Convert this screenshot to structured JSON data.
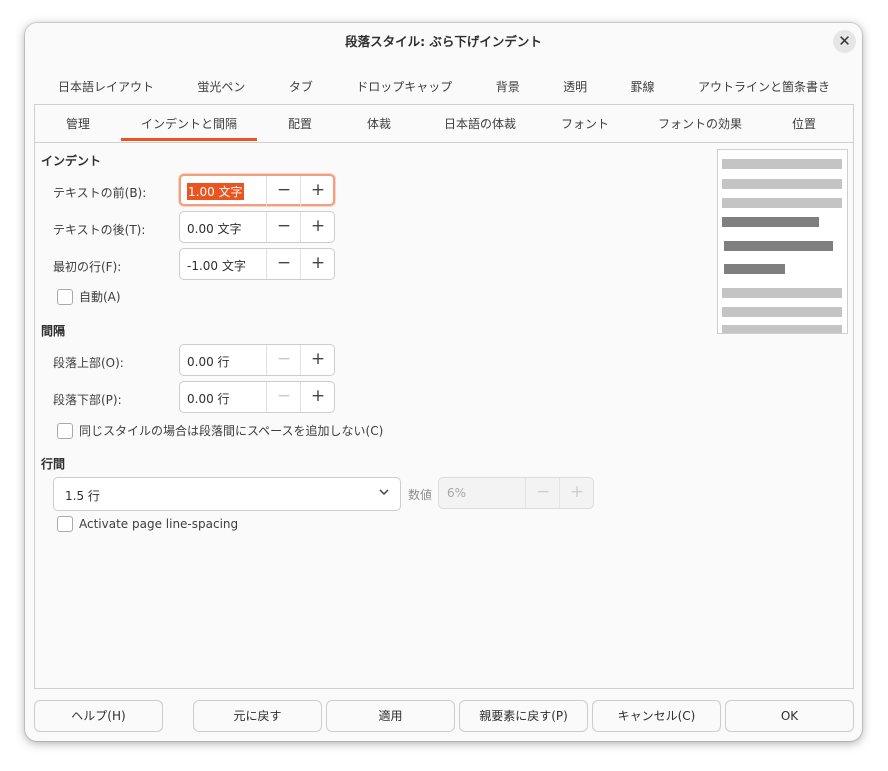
{
  "dialog": {
    "title": "段落スタイル: ぶら下げインデント"
  },
  "tabs_row1": [
    {
      "label": "日本語レイアウト"
    },
    {
      "label": "蛍光ペン"
    },
    {
      "label": "タブ"
    },
    {
      "label": "ドロップキャップ"
    },
    {
      "label": "背景"
    },
    {
      "label": "透明"
    },
    {
      "label": "罫線"
    },
    {
      "label": "アウトラインと箇条書き"
    }
  ],
  "tabs_row2": [
    {
      "label": "管理",
      "active": false
    },
    {
      "label": "インデントと間隔",
      "active": true
    },
    {
      "label": "配置",
      "active": false
    },
    {
      "label": "体裁",
      "active": false
    },
    {
      "label": "日本語の体裁",
      "active": false
    },
    {
      "label": "フォント",
      "active": false
    },
    {
      "label": "フォントの効果",
      "active": false
    },
    {
      "label": "位置",
      "active": false
    }
  ],
  "indent": {
    "title": "インデント",
    "before_label": "テキストの前(B):",
    "before_value": "1.00 文字",
    "after_label": "テキストの後(T):",
    "after_value": "0.00 文字",
    "first_label": "最初の行(F):",
    "first_value": "-1.00 文字",
    "auto_label": "自動(A)"
  },
  "spacing": {
    "title": "間隔",
    "above_label": "段落上部(O):",
    "above_value": "0.00 行",
    "below_label": "段落下部(P):",
    "below_value": "0.00 行",
    "no_space_label": "同じスタイルの場合は段落間にスペースを追加しない(C)"
  },
  "line_spacing": {
    "title": "行間",
    "selected": "1.5 行",
    "value_label": "数値",
    "value": "6%",
    "page_linespacing_label": "Activate page line-spacing"
  },
  "icons": {
    "minus": "−",
    "plus": "+",
    "close": "✕",
    "chevron": "⌄"
  },
  "colors": {
    "accent": "#e95420",
    "preview_gray_light": "#c4c4c4",
    "preview_gray_dark": "#7f7f7f"
  },
  "footer": {
    "help": "ヘルプ(H)",
    "reset": "元に戻す",
    "apply": "適用",
    "reset_parent": "親要素に戻す(P)",
    "cancel": "キャンセル(C)",
    "ok": "OK"
  }
}
